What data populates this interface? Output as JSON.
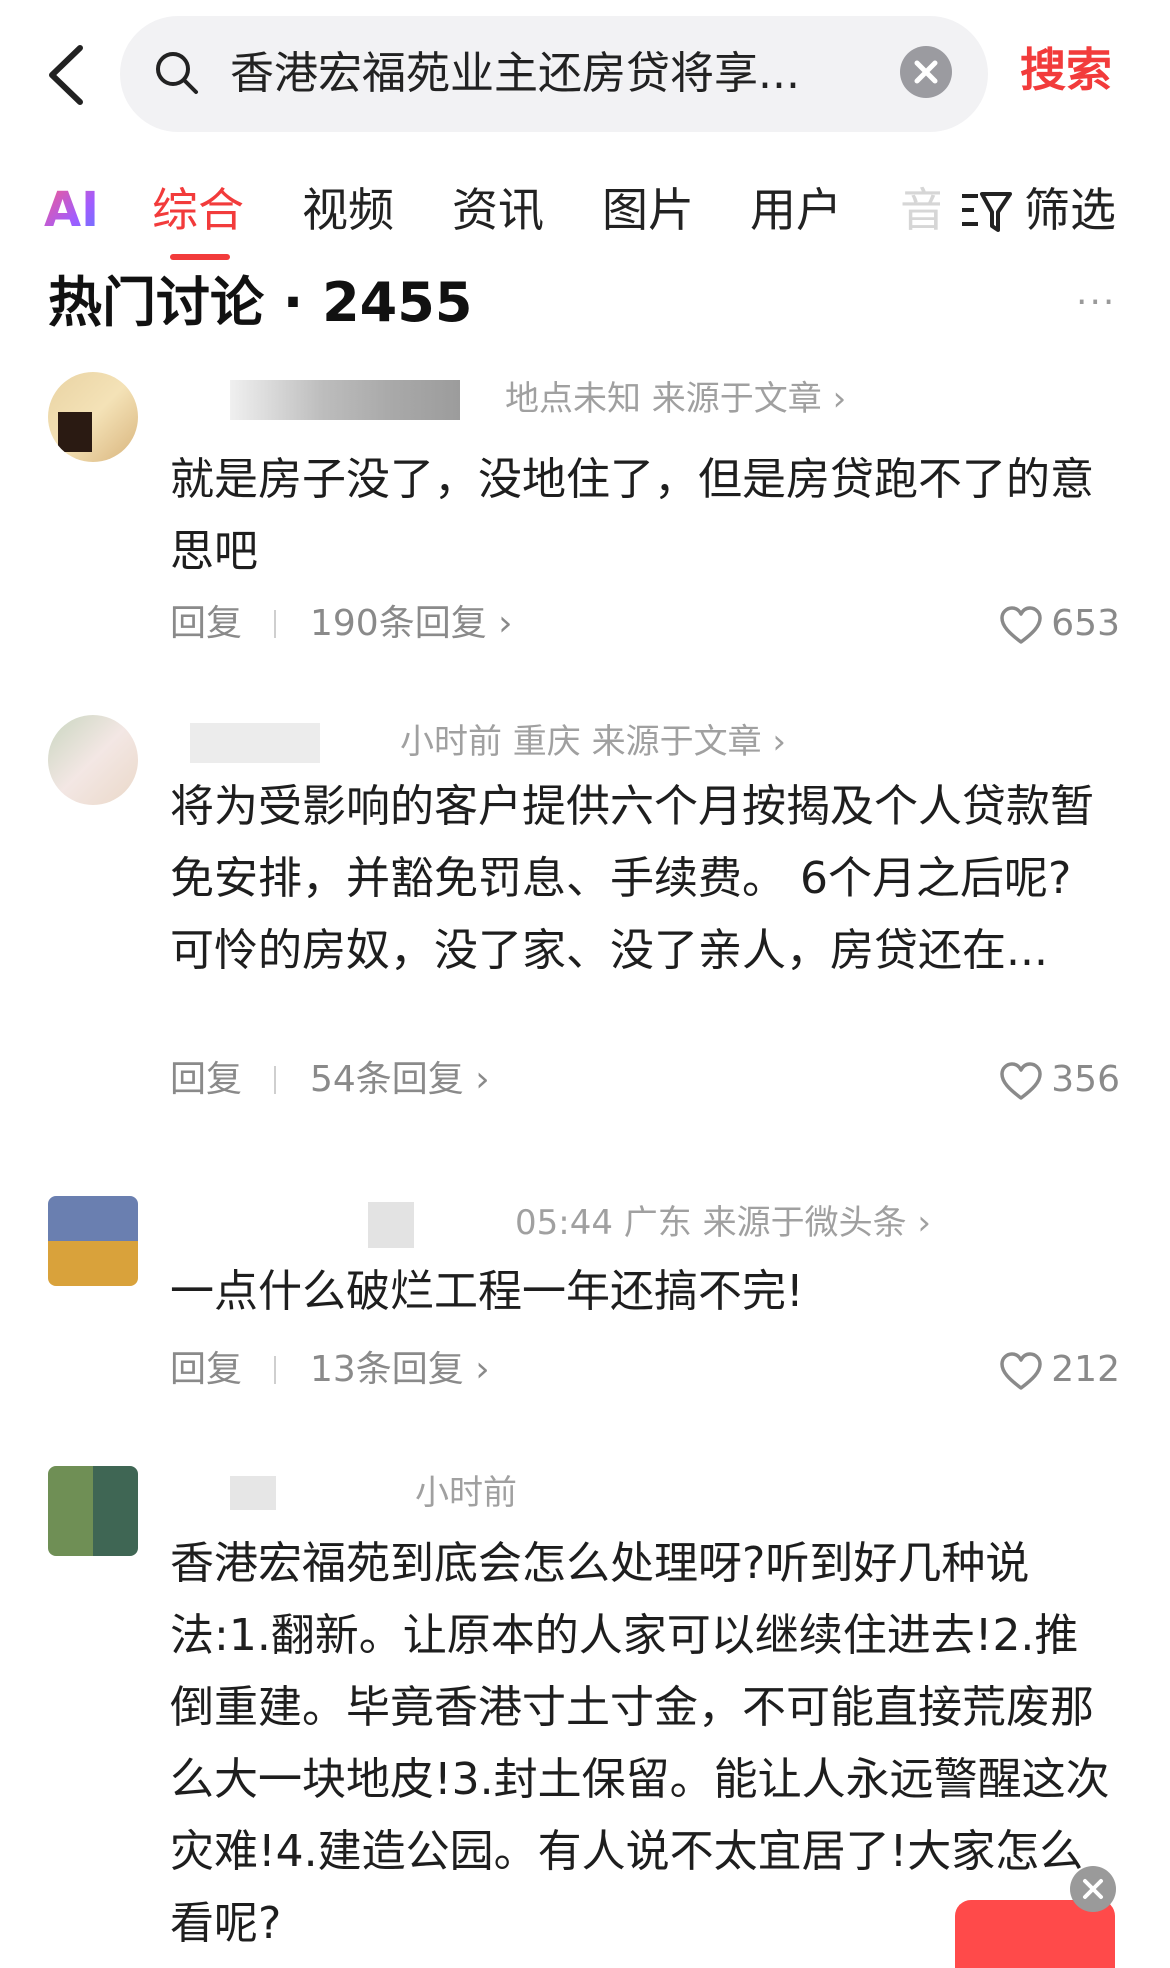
{
  "search": {
    "query": "香港宏福苑业主还房贷将享...",
    "search_button": "搜索"
  },
  "tabs": {
    "ai": "AI",
    "items": [
      "综合",
      "视频",
      "资讯",
      "图片",
      "用户"
    ],
    "partial": "音",
    "filter": "筛选"
  },
  "section": {
    "title": "热门讨论 · 2455",
    "more": "···"
  },
  "comments": [
    {
      "meta": "地点未知   来源于文章 ›",
      "text": "就是房子没了，没地住了，但是房贷跑不了的意思吧",
      "reply": "回复",
      "reply_count": "190条回复 ›",
      "likes": "653"
    },
    {
      "meta": "小时前   重庆   来源于文章 ›",
      "text": "将为受影响的客户提供六个月按揭及个人贷款暂免安排，并豁免罚息、手续费。 6个月之后呢? 可怜的房奴，没了家、没了亲人，房贷还在...",
      "reply": "回复",
      "reply_count": "54条回复 ›",
      "likes": "356"
    },
    {
      "meta": "05:44   广东   来源于微头条 ›",
      "text": "一点什么破烂工程一年还搞不完!",
      "reply": "回复",
      "reply_count": "13条回复 ›",
      "likes": "212"
    },
    {
      "meta": "小时前",
      "text": "香港宏福苑到底会怎么处理呀?听到好几种说法:1.翻新。让原本的人家可以继续住进去!2.推倒重建。毕竟香港寸土寸金，不可能直接荒废那么大一块地皮!3.封土保留。能让人永远警醒这次灾难!4.建造公园。有人说不太宜居了!大家怎么看呢?"
    }
  ],
  "colors": {
    "accent": "#f23b3b",
    "muted": "#a0a0a0"
  }
}
